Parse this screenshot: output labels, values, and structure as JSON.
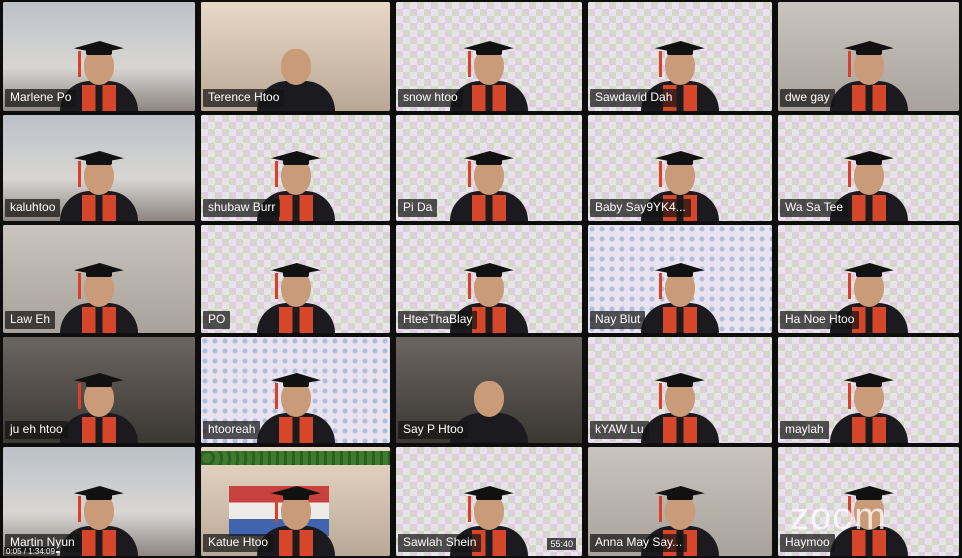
{
  "participants": [
    {
      "name": "Marlene Po",
      "bg": "room"
    },
    {
      "name": "Terence Htoo",
      "bg": "warm",
      "nocap": true
    },
    {
      "name": "snow htoo",
      "bg": "check"
    },
    {
      "name": "Sawdavid Dah",
      "bg": "check"
    },
    {
      "name": "dwe gay",
      "bg": "wall"
    },
    {
      "name": "kaluhtoo",
      "bg": "room"
    },
    {
      "name": "shubaw Burr",
      "bg": "check"
    },
    {
      "name": "Pi Da",
      "bg": "check"
    },
    {
      "name": "Baby Say9YK4...",
      "bg": "check"
    },
    {
      "name": "Wa Sa Tee",
      "bg": "check"
    },
    {
      "name": "Law Eh",
      "bg": "wall"
    },
    {
      "name": "PO",
      "bg": "check"
    },
    {
      "name": "HteeThaBlay",
      "bg": "check"
    },
    {
      "name": "Nay Blut",
      "bg": "floral"
    },
    {
      "name": "Ha Noe Htoo",
      "bg": "check"
    },
    {
      "name": "ju eh htoo",
      "bg": "dark"
    },
    {
      "name": "htooreah",
      "bg": "floral"
    },
    {
      "name": "Say P Htoo",
      "bg": "dark",
      "nocap": true
    },
    {
      "name": "kYAW Lu",
      "bg": "check"
    },
    {
      "name": "maylah",
      "bg": "check"
    },
    {
      "name": "Martin Nyun",
      "bg": "room"
    },
    {
      "name": "Katue Htoo",
      "bg": "warm",
      "flag": true
    },
    {
      "name": "Sawlah Shein",
      "bg": "check",
      "active": true,
      "timer": "55:40"
    },
    {
      "name": "Anna May Say...",
      "bg": "wall"
    },
    {
      "name": "Haymoo",
      "bg": "check"
    }
  ],
  "watermark": "zoom",
  "playback": {
    "time": "0:05 / 1:34:09",
    "progress": 0.004
  },
  "colors": {
    "active_border": "#b8e04a",
    "nametag_bg": "#141414"
  }
}
